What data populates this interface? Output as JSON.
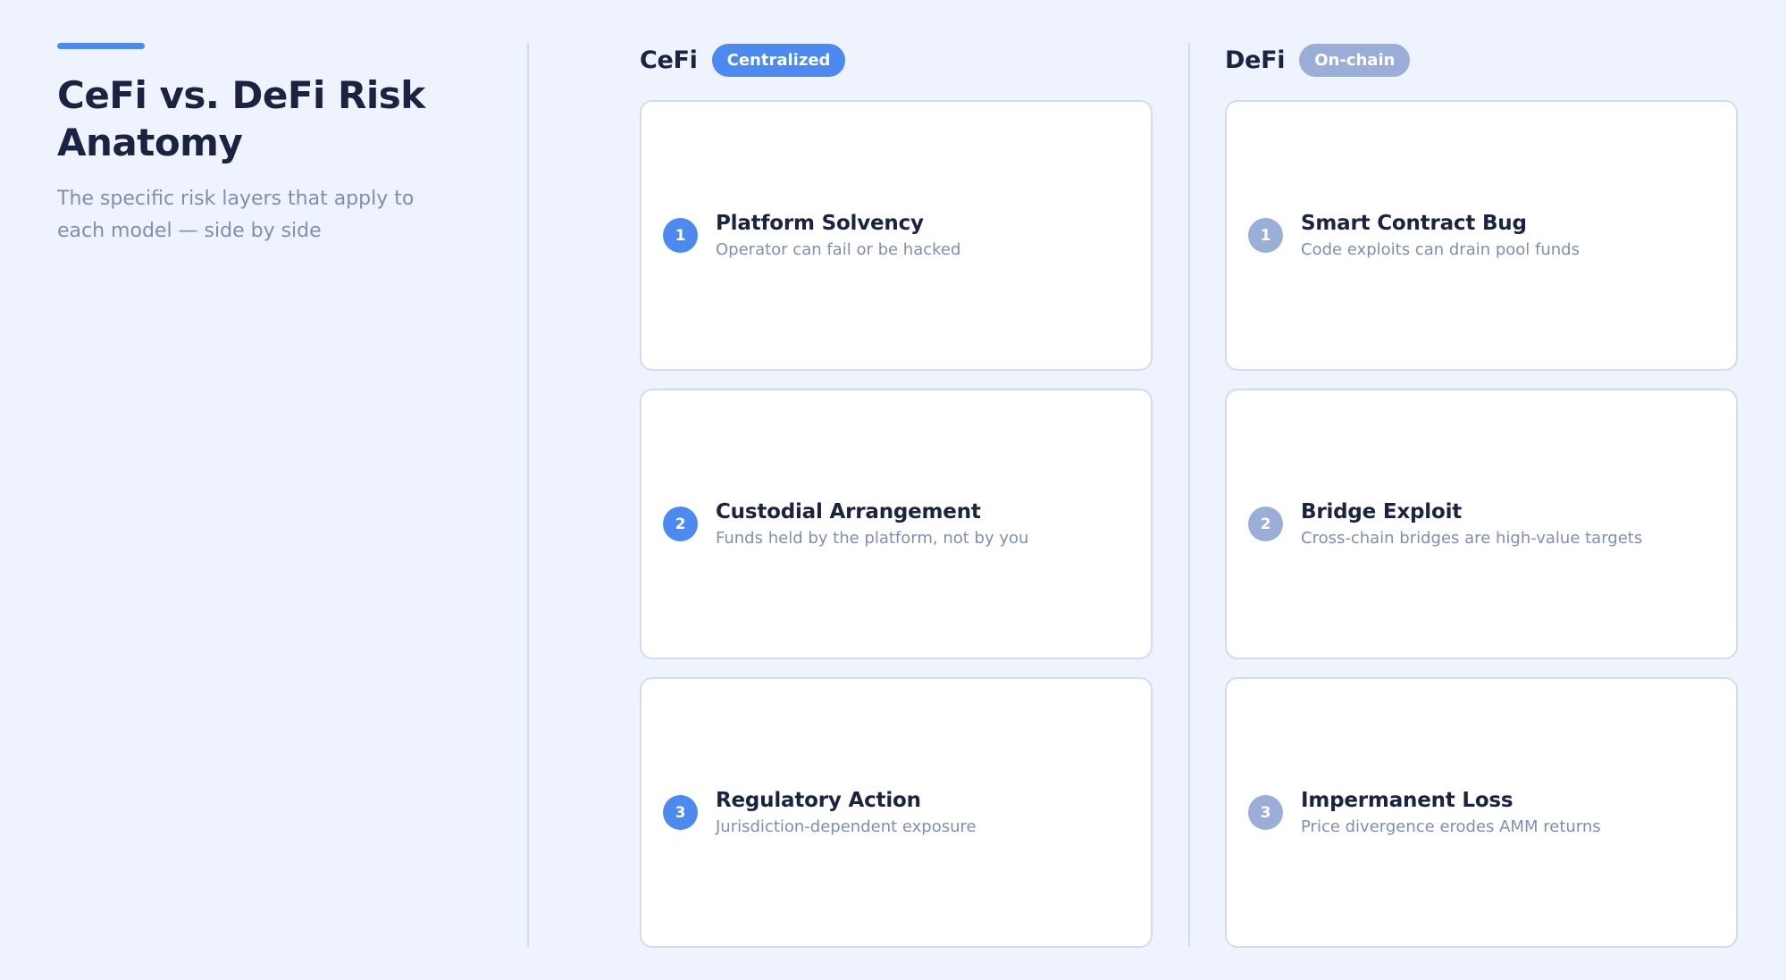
{
  "header": {
    "title": "CeFi vs. DeFi Risk Anatomy",
    "subtitle": "The specific risk layers that apply to each model — side by side"
  },
  "cefi": {
    "title": "CeFi",
    "badge": "Centralized",
    "items": [
      {
        "num": "1",
        "title": "Platform Solvency",
        "desc": "Operator can fail or be hacked"
      },
      {
        "num": "2",
        "title": "Custodial Arrangement",
        "desc": "Funds held by the platform, not by you"
      },
      {
        "num": "3",
        "title": "Regulatory Action",
        "desc": "Jurisdiction-dependent exposure"
      }
    ]
  },
  "defi": {
    "title": "DeFi",
    "badge": "On-chain",
    "items": [
      {
        "num": "1",
        "title": "Smart Contract Bug",
        "desc": "Code exploits can drain pool funds"
      },
      {
        "num": "2",
        "title": "Bridge Exploit",
        "desc": "Cross-chain bridges are high-value targets"
      },
      {
        "num": "3",
        "title": "Impermanent Loss",
        "desc": "Price divergence erodes AMM returns"
      }
    ]
  },
  "colors": {
    "accent": "#4d8af0",
    "muted_accent": "#9aaed8",
    "background": "#eef3fe",
    "heading": "#1a2340",
    "body_text": "#7e8fb2"
  }
}
